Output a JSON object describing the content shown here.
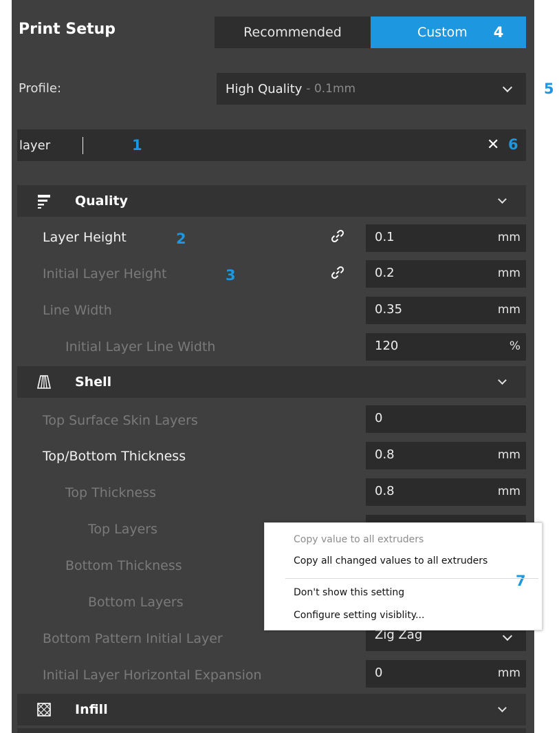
{
  "header": {
    "title": "Print Setup",
    "tabs": [
      {
        "label": "Recommended",
        "active": false
      },
      {
        "label": "Custom",
        "active": true
      }
    ]
  },
  "profile": {
    "label": "Profile:",
    "name": "High Quality",
    "sublabel": "- 0.1mm"
  },
  "search": {
    "value": "layer"
  },
  "callouts": [
    "1",
    "2",
    "3",
    "4",
    "5",
    "6",
    "7"
  ],
  "categories": [
    {
      "label": "Quality",
      "icon": "quality-icon"
    },
    {
      "label": "Shell",
      "icon": "shell-icon"
    },
    {
      "label": "Infill",
      "icon": "infill-icon"
    }
  ],
  "settings": [
    {
      "label": "Layer Height",
      "value": "0.1",
      "unit": "mm",
      "active": true,
      "linked": true
    },
    {
      "label": "Initial Layer Height",
      "value": "0.2",
      "unit": "mm",
      "active": false,
      "linked": true
    },
    {
      "label": "Line Width",
      "value": "0.35",
      "unit": "mm",
      "active": false
    },
    {
      "label": "Initial Layer Line Width",
      "value": "120",
      "unit": "%",
      "active": false
    },
    {
      "label": "Top Surface Skin Layers",
      "value": "0",
      "unit": "",
      "active": false
    },
    {
      "label": "Top/Bottom Thickness",
      "value": "0.8",
      "unit": "mm",
      "active": true
    },
    {
      "label": "Top Thickness",
      "value": "0.8",
      "unit": "mm",
      "active": false
    },
    {
      "label": "Top Layers",
      "value": "",
      "unit": "",
      "active": false
    },
    {
      "label": "Bottom Thickness",
      "value": "",
      "unit": "",
      "active": false
    },
    {
      "label": "Bottom Layers",
      "value": "",
      "unit": "",
      "active": false
    },
    {
      "label": "Bottom Pattern Initial Layer",
      "value": "Zig Zag",
      "unit": "",
      "active": false,
      "dropdown": true
    },
    {
      "label": "Initial Layer Horizontal Expansion",
      "value": "0",
      "unit": "mm",
      "active": false
    }
  ],
  "context_menu": {
    "items": [
      {
        "label": "Copy value to all extruders",
        "enabled": false
      },
      {
        "label": "Copy all changed values to all extruders",
        "enabled": true
      },
      {
        "label": "Don't show this setting",
        "enabled": true
      },
      {
        "label": "Configure setting visiblity...",
        "enabled": true
      }
    ]
  },
  "colors": {
    "panel_bg": "#3f3f3f",
    "field_bg": "#2e2e2e",
    "accent": "#1c97e0",
    "active_text": "#f2f2f2",
    "dim_text": "#7a7a7a"
  }
}
